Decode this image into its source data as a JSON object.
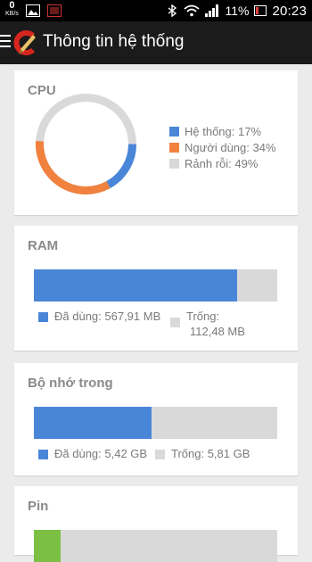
{
  "status_bar": {
    "net_speed_value": "0",
    "net_speed_unit": "KB/s",
    "battery_percent": "11%",
    "time": "20:23"
  },
  "app_bar": {
    "title": "Thông tin hệ thống",
    "menu_icon": "hamburger-icon",
    "logo": "ccleaner-logo"
  },
  "cpu": {
    "title": "CPU",
    "legend": [
      {
        "label": "Hệ thống: 17%",
        "percent": 17,
        "color": "#4a86d8"
      },
      {
        "label": "Người dùng: 34%",
        "percent": 34,
        "color": "#f1813f"
      },
      {
        "label": "Rảnh rỗi: 49%",
        "percent": 49,
        "color": "#d9d9d9"
      }
    ]
  },
  "ram": {
    "title": "RAM",
    "used_fraction": 0.835,
    "used_label": "Đã dùng: 567,91 MB",
    "free_label_line1": "Trống:",
    "free_label_line2": "112,48 MB",
    "used_color": "#4a86d8",
    "free_color": "#d9d9d9"
  },
  "storage": {
    "title": "Bộ nhớ trong",
    "used_fraction": 0.483,
    "used_label": "Đã dùng: 5,42 GB",
    "free_label": "Trống: 5,81 GB",
    "used_color": "#4a86d8",
    "free_color": "#d9d9d9"
  },
  "battery": {
    "title": "Pin",
    "level_fraction": 0.11,
    "level_color": "#7bc043"
  }
}
